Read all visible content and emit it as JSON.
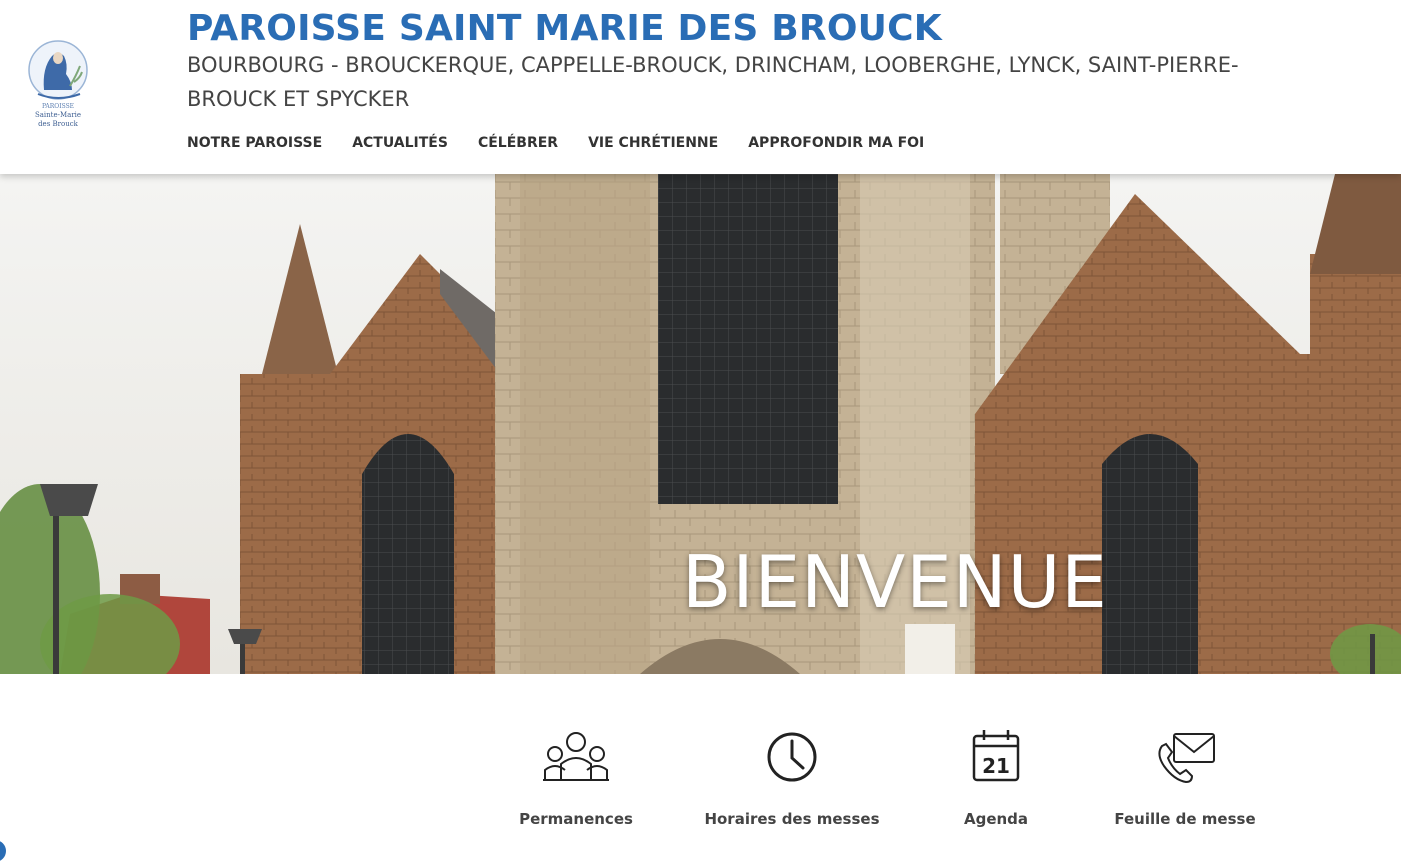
{
  "header": {
    "logo_line1": "PAROISSE",
    "logo_line2": "Sainte-Marie",
    "logo_line3": "des Brouck",
    "title": "PAROISSE SAINT MARIE DES BROUCK",
    "subtitle": "BOURBOURG - BROUCKERQUE, CAPPELLE-BROUCK, DRINCHAM, LOOBERGHE, LYNCK, SAINT-PIERRE-BROUCK ET SPYCKER"
  },
  "nav": {
    "items": [
      {
        "label": "NOTRE PAROISSE"
      },
      {
        "label": "ACTUALITÉS"
      },
      {
        "label": "CÉLÉBRER"
      },
      {
        "label": "VIE CHRÉTIENNE"
      },
      {
        "label": "APPROFONDIR MA FOI"
      }
    ]
  },
  "hero": {
    "title": "BIENVENUE"
  },
  "quick_links": [
    {
      "label": "Permanences",
      "icon": "people-icon"
    },
    {
      "label": "Horaires des messes",
      "icon": "clock-icon"
    },
    {
      "label": "Agenda",
      "icon": "calendar-icon",
      "day": "21"
    },
    {
      "label": "Feuille de messe",
      "icon": "envelope-phone-icon"
    }
  ],
  "colors": {
    "brand_blue": "#2a6db5",
    "nav_text": "#333333",
    "brick": "#9a6a45",
    "stone": "#c9b79a"
  }
}
